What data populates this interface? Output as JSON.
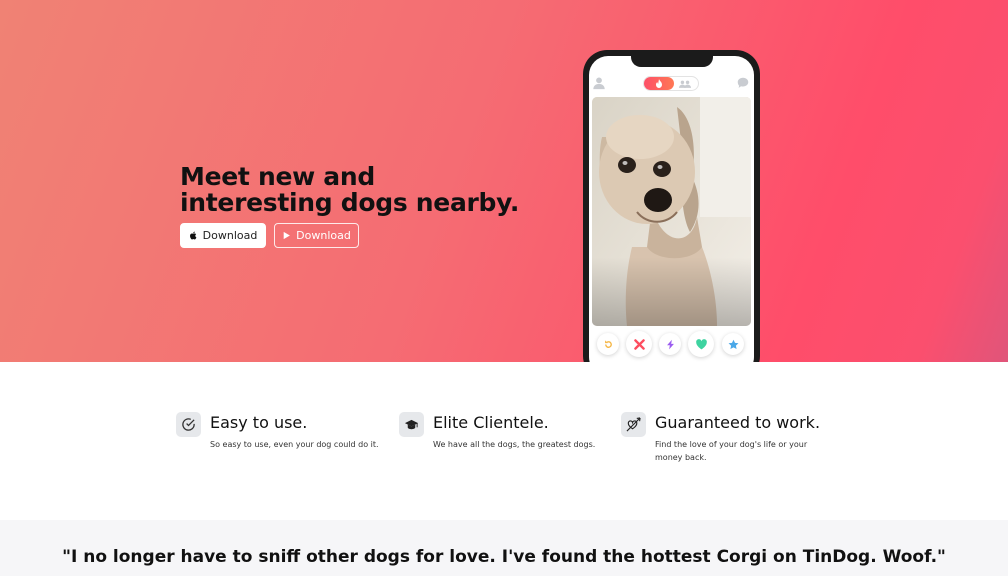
{
  "hero": {
    "title": "Meet new and interesting dogs nearby.",
    "apple_button_label": "Download",
    "play_button_label": "Download",
    "gradient_start": "#f08274",
    "gradient_end": "#ff4d6a"
  },
  "phone": {
    "top_icons": [
      "profile-icon",
      "flame-icon",
      "group-icon",
      "chat-icon"
    ],
    "action_icons": [
      "rewind-icon",
      "close-icon",
      "boost-icon",
      "heart-icon",
      "star-icon"
    ],
    "action_colors": {
      "rewind": "#f5b748",
      "nope": "#fd4d5f",
      "boost": "#9b5cf0",
      "like": "#3ed3a0",
      "super_like": "#4aa8e8"
    }
  },
  "features": [
    {
      "icon": "check-circle-icon",
      "title": "Easy to use.",
      "text": "So easy to use, even your dog could do it."
    },
    {
      "icon": "graduation-cap-icon",
      "title": "Elite Clientele.",
      "text": "We have all the dogs, the greatest dogs."
    },
    {
      "icon": "heart-arrow-icon",
      "title": "Guaranteed to work.",
      "text": "Find the love of your dog's life or your money back."
    }
  ],
  "testimonial": {
    "quote": "\"I no longer have to sniff other dogs for love. I've found the hottest Corgi on TinDog. Woof.\""
  }
}
